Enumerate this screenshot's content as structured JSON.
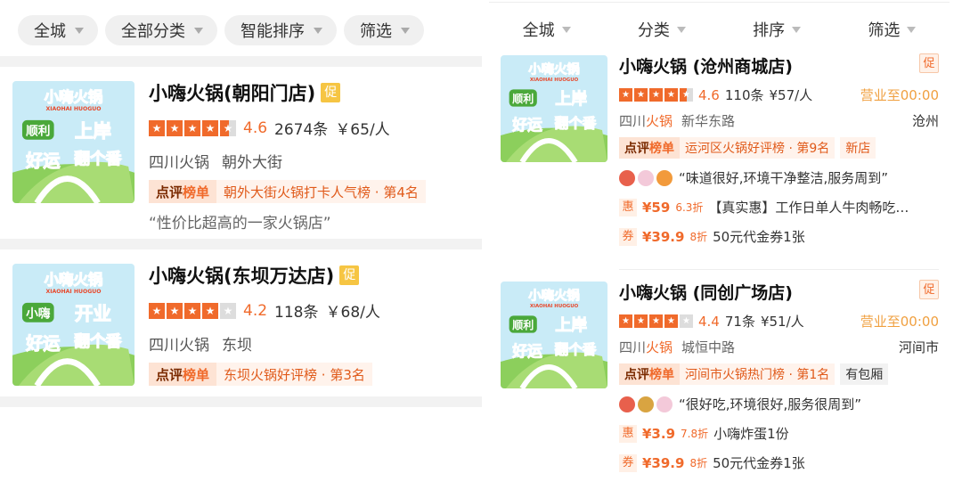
{
  "left": {
    "filters": [
      {
        "label": "全城",
        "name": "filter-city"
      },
      {
        "label": "全部分类",
        "name": "filter-category"
      },
      {
        "label": "智能排序",
        "name": "filter-sort"
      },
      {
        "label": "筛选",
        "name": "filter-screen"
      }
    ],
    "cards": [
      {
        "title": "小嗨火锅(朝阳门店)",
        "promo": "促",
        "stars": 4.5,
        "score": "4.6",
        "reviews": "2674条",
        "price": "￥65/人",
        "category": "四川火锅",
        "area": "朝外大街",
        "rank_tag": "点评榜单",
        "rank_text": "朝外大街火锅打卡人气榜 · 第4名",
        "quote": "“性价比超高的一家火锅店”",
        "thumb": {
          "brand": "小嗨火锅",
          "sub": "XIAOHAI HUOGUO",
          "line1a": "顺利",
          "line1b": "上岸",
          "line2a": "好运",
          "line2b": "翻个番"
        }
      },
      {
        "title": "小嗨火锅(东坝万达店)",
        "promo": "促",
        "stars": 4,
        "score": "4.2",
        "reviews": "118条",
        "price": "￥68/人",
        "category": "四川火锅",
        "area": "东坝",
        "rank_tag": "点评榜单",
        "rank_text": "东坝火锅好评榜 · 第3名",
        "thumb": {
          "brand": "小嗨火锅",
          "sub": "XIAOHAI HUOGUO",
          "line1a": "小嗨",
          "line1b": "开业",
          "line2a": "好运",
          "line2b": "翻个番"
        }
      }
    ]
  },
  "right": {
    "tabs": [
      {
        "label": "全城",
        "name": "tab-city"
      },
      {
        "label": "分类",
        "name": "tab-category"
      },
      {
        "label": "排序",
        "name": "tab-sort"
      },
      {
        "label": "筛选",
        "name": "tab-screen"
      }
    ],
    "cards": [
      {
        "title": "小嗨火锅 (沧州商城店)",
        "promo": "促",
        "stars": 4.5,
        "score": "4.6",
        "reviews": "110条",
        "price": "¥57/人",
        "hours": "营业至00:00",
        "category_prefix": "四川",
        "category_hl": "火锅",
        "street": "新华东路",
        "city": "沧州",
        "rank_tag": "点评榜单",
        "rank_text": "运河区火锅好评榜 · 第9名",
        "extra": "新店",
        "review": "“味道很好,环境干净整洁,服务周到”",
        "deals": [
          {
            "tag": "惠",
            "price": "¥59",
            "disc": "6.3折",
            "text": "【真实惠】工作日单人牛肉畅吃…"
          },
          {
            "tag": "券",
            "price": "¥39.9",
            "disc": "8折",
            "text": "50元代金券1张"
          }
        ],
        "thumb": {
          "brand": "小嗨火锅",
          "sub": "XIAOHAI HUOGUO",
          "line1a": "顺利",
          "line1b": "上岸",
          "line2a": "好运",
          "line2b": "翻个番"
        }
      },
      {
        "title": "小嗨火锅 (同创广场店)",
        "promo": "促",
        "stars": 4,
        "score": "4.4",
        "reviews": "71条",
        "price": "¥51/人",
        "hours": "营业至00:00",
        "category_prefix": "四川",
        "category_hl": "火锅",
        "street": "城恒中路",
        "city": "河间市",
        "rank_tag": "点评榜单",
        "rank_text": "河间市火锅热门榜 · 第1名",
        "extra": "有包厢",
        "review": "“很好吃,环境很好,服务很周到”",
        "deals": [
          {
            "tag": "惠",
            "price": "¥3.9",
            "disc": "7.8折",
            "text": "小嗨炸蛋1份"
          },
          {
            "tag": "券",
            "price": "¥39.9",
            "disc": "8折",
            "text": "50元代金券1张"
          }
        ],
        "thumb": {
          "brand": "小嗨火锅",
          "sub": "XIAOHAI HUOGUO",
          "line1a": "顺利",
          "line1b": "上岸",
          "line2a": "好运",
          "line2b": "翻个番"
        }
      }
    ]
  },
  "colors": {
    "accent": "#f06a2b",
    "hours": "#f0a040",
    "promo_left": "#f6c543"
  }
}
